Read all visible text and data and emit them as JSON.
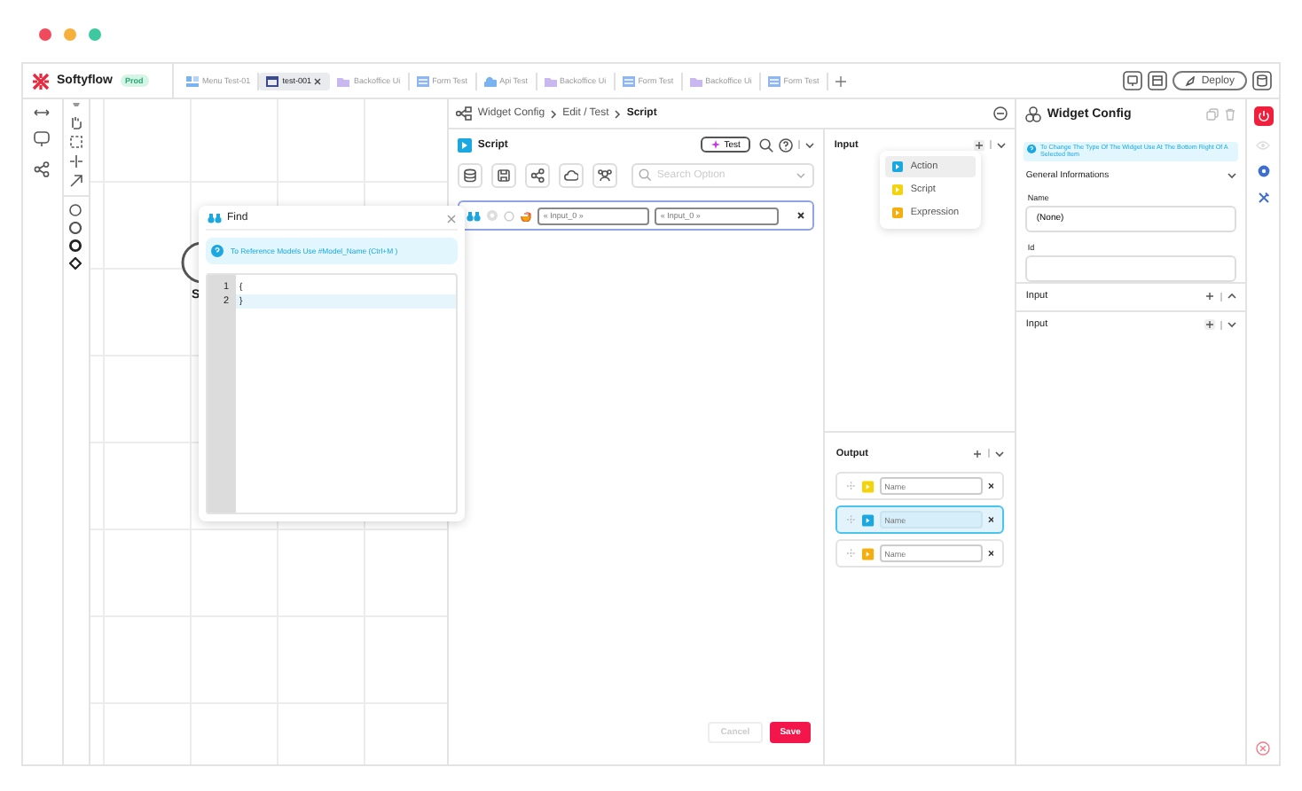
{
  "brand": {
    "name": "Softyflow",
    "badge": "Prod"
  },
  "tabs": [
    {
      "label": "Menu Test-01",
      "kind": "menu",
      "selected": false,
      "closable": false
    },
    {
      "label": "test-001",
      "kind": "page",
      "selected": true,
      "closable": true
    },
    {
      "label": "Backoffice Ui",
      "kind": "folder",
      "selected": false,
      "closable": false
    },
    {
      "label": "Form Test",
      "kind": "form",
      "selected": false,
      "closable": false
    },
    {
      "label": "Api Test",
      "kind": "cloud",
      "selected": false,
      "closable": false
    },
    {
      "label": "Backoffice Ui",
      "kind": "folder",
      "selected": false,
      "closable": false
    },
    {
      "label": "Form Test",
      "kind": "form",
      "selected": false,
      "closable": false
    },
    {
      "label": "Backoffice Ui",
      "kind": "folder",
      "selected": false,
      "closable": false
    },
    {
      "label": "Form Test",
      "kind": "form",
      "selected": false,
      "closable": false
    }
  ],
  "deploy_button": "Deploy",
  "canvas": {
    "node_label": "S"
  },
  "find_dialog": {
    "title": "Find",
    "info": "To Reference Models Use #Model_Name (Ctrl+M )",
    "lines": [
      {
        "number": "1",
        "code": "{",
        "selected": false
      },
      {
        "number": "2",
        "code": "}",
        "selected": true
      }
    ]
  },
  "breadcrumb": [
    "Widget Config",
    "Edit / Test",
    "Script"
  ],
  "script": {
    "title": "Script",
    "test_button": "Test",
    "search_placeholder": "Search Option",
    "row": {
      "fields": [
        {
          "placeholder": "« Input_0 »"
        },
        {
          "placeholder": "« Input_0 »"
        }
      ]
    },
    "buttons": [
      {
        "label": "Cancel",
        "kind": "secondary",
        "disabled": true
      },
      {
        "label": "Save",
        "kind": "primary",
        "disabled": false
      }
    ]
  },
  "input": {
    "title": "Input",
    "menu": [
      {
        "label": "Action",
        "color": "#1ba7e0",
        "selected": true
      },
      {
        "label": "Script",
        "color": "#f3d40c",
        "selected": false
      },
      {
        "label": "Expression",
        "color": "#f6ad0e",
        "selected": false
      }
    ]
  },
  "output": {
    "title": "Output",
    "rows": [
      {
        "color": "#f3d40c",
        "placeholder": "Name",
        "selected": false
      },
      {
        "color": "#1ba7e0",
        "placeholder": "Name",
        "selected": true
      },
      {
        "color": "#f6ad0e",
        "placeholder": "Name",
        "selected": false
      }
    ]
  },
  "widget_config": {
    "title": "Widget Config",
    "info": "To Change The Type Of The Widget Use At The Bottom Right Of A Selected Item",
    "section": "General Informations",
    "fields": [
      {
        "label": "Name",
        "value": "(None)"
      },
      {
        "label": "Id"
      }
    ],
    "groups": [
      {
        "title": "Input",
        "expanded": true
      },
      {
        "title": "Input",
        "expanded": false
      }
    ]
  }
}
